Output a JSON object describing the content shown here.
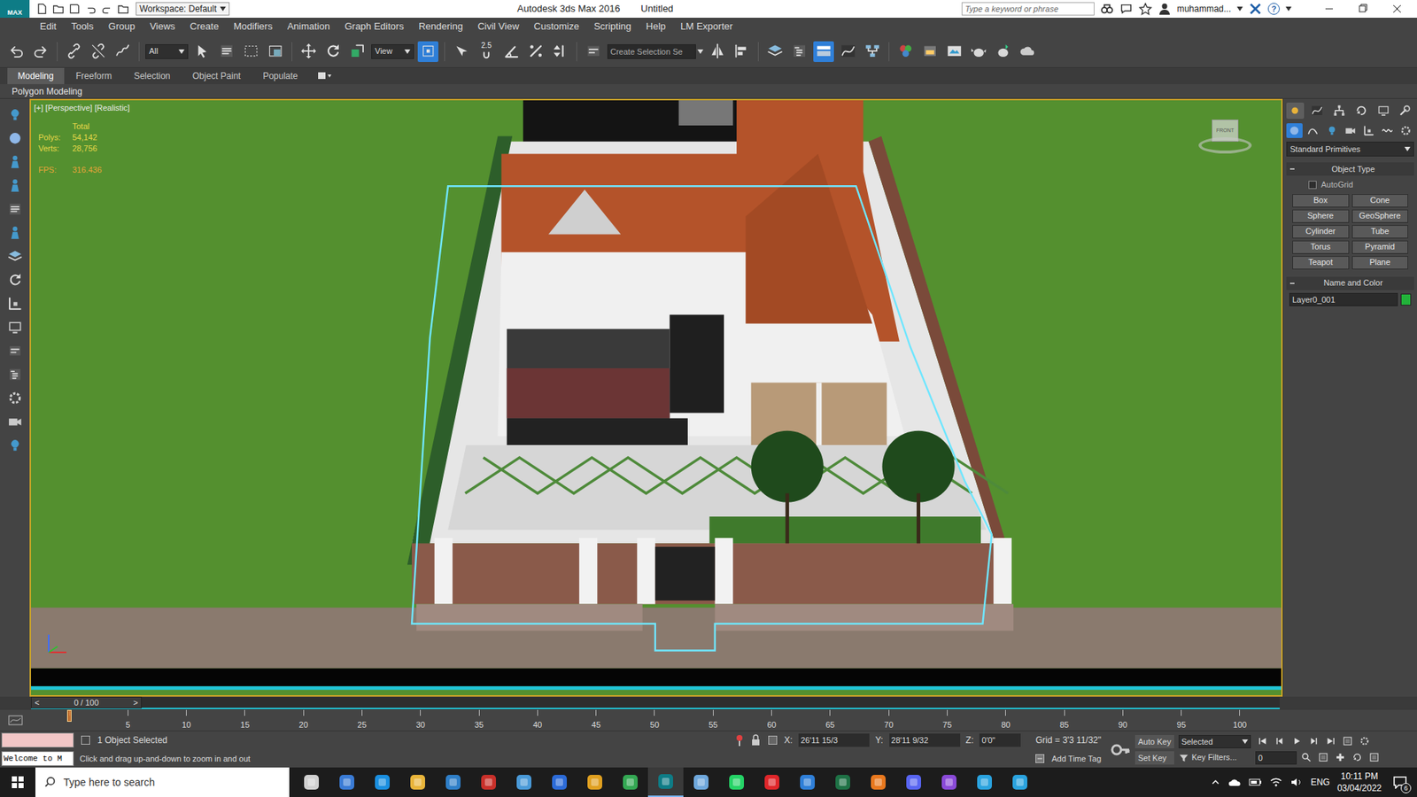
{
  "title_bar": {
    "logo": "MAX",
    "workspace": "Workspace: Default",
    "app": "Autodesk 3ds Max 2016",
    "document": "Untitled",
    "search_placeholder": "Type a keyword or phrase",
    "user": "muhammad...",
    "help": "?"
  },
  "menu": [
    "Edit",
    "Tools",
    "Group",
    "Views",
    "Create",
    "Modifiers",
    "Animation",
    "Graph Editors",
    "Rendering",
    "Civil View",
    "Customize",
    "Scripting",
    "Help",
    "LM Exporter"
  ],
  "toolbar": {
    "selection_filter": "All",
    "reference_coord": "View",
    "snap": "2.5",
    "named_selection_placeholder": "Create Selection Se",
    "pivot_center_on": true,
    "ribbon_on": true
  },
  "ribbon": {
    "tabs": [
      {
        "label": "Modeling",
        "selected": true
      },
      {
        "label": "Freeform",
        "selected": false
      },
      {
        "label": "Selection",
        "selected": false
      },
      {
        "label": "Object Paint",
        "selected": false
      },
      {
        "label": "Populate",
        "selected": false
      }
    ],
    "panel": "Polygon Modeling"
  },
  "viewport": {
    "label": "[+] [Perspective] [Realistic]",
    "stats": {
      "header": "Total",
      "polys_label": "Polys:",
      "polys": "54,142",
      "verts_label": "Verts:",
      "verts": "28,756",
      "fps_label": "FPS:",
      "fps": "316.436"
    },
    "viewcube": "FRONT",
    "selected_object": true
  },
  "command_panel": {
    "tabs": [
      {
        "selected": true
      },
      {
        "selected": false
      },
      {
        "selected": false
      },
      {
        "selected": false
      },
      {
        "selected": false
      },
      {
        "selected": false
      }
    ],
    "categories": [
      {
        "selected": true
      },
      {
        "selected": false
      },
      {
        "selected": false
      },
      {
        "selected": false
      },
      {
        "selected": false
      },
      {
        "selected": false
      },
      {
        "selected": false
      }
    ],
    "category": "Standard Primitives",
    "object_type_title": "Object Type",
    "autogrid": {
      "label": "AutoGrid",
      "checked": false
    },
    "buttons": [
      "Box",
      "Cone",
      "Sphere",
      "GeoSphere",
      "Cylinder",
      "Tube",
      "Torus",
      "Pyramid",
      "Teapot",
      "Plane"
    ],
    "name_color_title": "Name and Color",
    "object_name": "Layer0_001",
    "object_color": "#22b33a"
  },
  "timeline": {
    "prev": "<",
    "position": "0 / 100",
    "next": ">",
    "level": 0,
    "ticks": [
      "5",
      "10",
      "15",
      "20",
      "25",
      "30",
      "35",
      "40",
      "45",
      "50",
      "55",
      "60",
      "65",
      "70",
      "75",
      "80",
      "85",
      "90",
      "95",
      "100"
    ]
  },
  "status": {
    "selection": "1 Object Selected",
    "prompt": "Click and drag up-and-down to zoom in and out",
    "maxscript": "Welcome to M",
    "x_label": "X:",
    "x": "26'11 15/3",
    "y_label": "Y:",
    "y": "28'11 9/32",
    "z_label": "Z:",
    "z": "0'0\"",
    "grid": "Grid = 3'3 11/32\"",
    "add_time_tag": "Add Time Tag",
    "auto_key": "Auto Key",
    "key_mode": "Selected",
    "set_key": "Set Key",
    "key_filters": "Key Filters...",
    "frame": "0"
  },
  "taskbar": {
    "search_placeholder": "Type here to search",
    "language": "ENG",
    "time": "10:11 PM",
    "date": "03/04/2022",
    "notifications": "6"
  }
}
